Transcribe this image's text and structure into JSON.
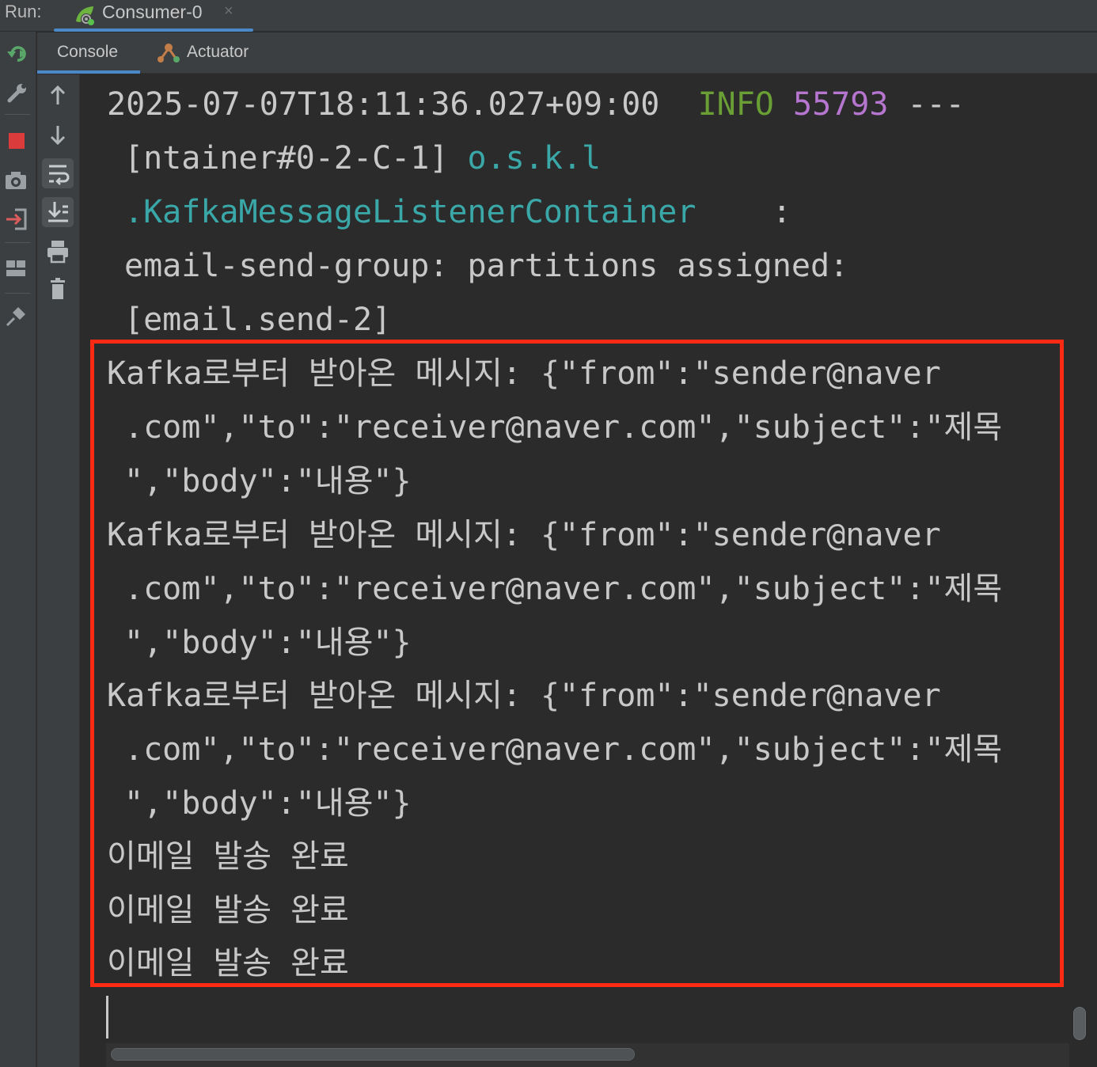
{
  "runbar": {
    "label": "Run:",
    "tab": {
      "title": "Consumer-0",
      "close": "×"
    }
  },
  "subtabs": {
    "console": "Console",
    "actuator": "Actuator"
  },
  "console": {
    "header": {
      "timestamp": "2025-07-07T18:11:36.027+09:00",
      "level": "INFO",
      "pid": "55793",
      "separator": "---",
      "thread": "[ntainer#0-2-C-1]",
      "logger_a": "o.s.k.l",
      "logger_b": ".KafkaMessageListenerContainer",
      "colon": ":",
      "message_a": "email-send-group: partitions assigned:",
      "message_b": "[email.send-2]"
    },
    "messages": [
      {
        "l1": "Kafka로부터 받아온 메시지: {\"from\":\"sender@naver",
        "l2": ".com\",\"to\":\"receiver@naver.com\",\"subject\":\"제목",
        "l3": "\",\"body\":\"내용\"}"
      },
      {
        "l1": "Kafka로부터 받아온 메시지: {\"from\":\"sender@naver",
        "l2": ".com\",\"to\":\"receiver@naver.com\",\"subject\":\"제목",
        "l3": "\",\"body\":\"내용\"}"
      },
      {
        "l1": "Kafka로부터 받아온 메시지: {\"from\":\"sender@naver",
        "l2": ".com\",\"to\":\"receiver@naver.com\",\"subject\":\"제목",
        "l3": "\",\"body\":\"내용\"}"
      }
    ],
    "done": [
      "이메일 발송 완료",
      "이메일 발송 완료",
      "이메일 발송 완료"
    ]
  },
  "colors": {
    "info": "#6a9f35",
    "pid": "#b676d0",
    "logger": "#3aa8a8",
    "highlight": "#ff2a14",
    "tab_underline": "#4a88c7"
  },
  "icons": {
    "run_tab": "spring-boot-icon",
    "actuator": "actuator-icon",
    "left_toolbar": [
      "rerun-icon",
      "wrench-icon",
      "stop-icon",
      "camera-icon",
      "sign-in-icon",
      "layout-icon",
      "pin-icon"
    ],
    "inner_toolbar": [
      "up-arrow-icon",
      "down-arrow-icon",
      "soft-wrap-icon",
      "scroll-to-end-icon",
      "print-icon",
      "trash-icon"
    ]
  }
}
